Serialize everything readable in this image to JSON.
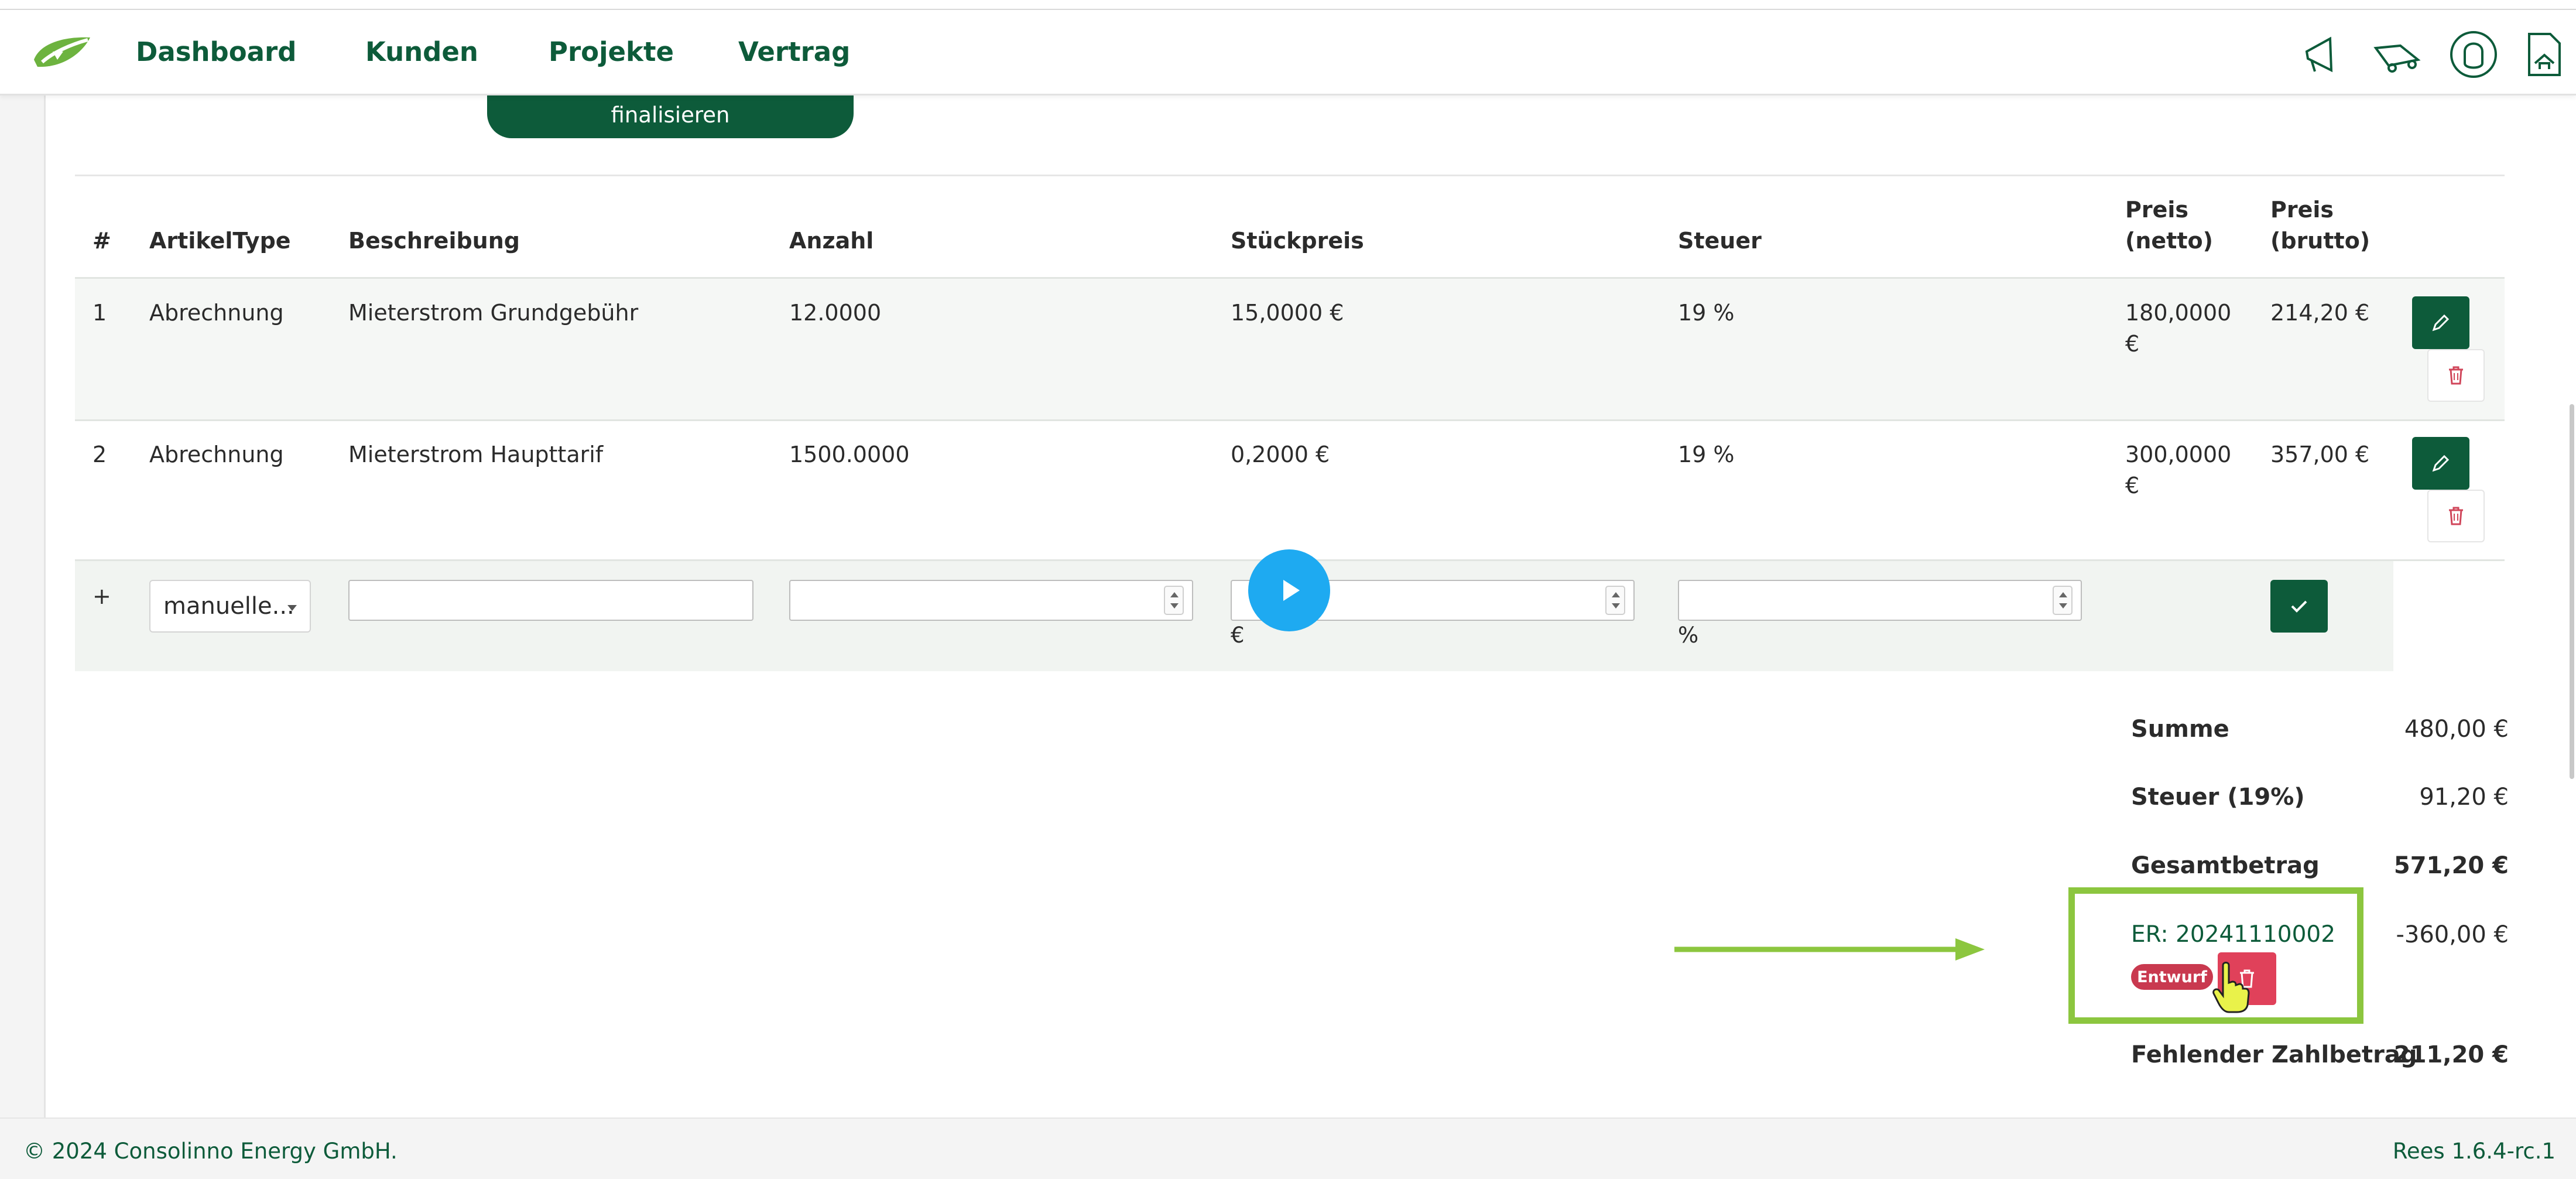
{
  "nav": {
    "items": [
      "Dashboard",
      "Kunden",
      "Projekte",
      "Vertrag"
    ]
  },
  "header_icons": [
    "megaphone-icon",
    "truck-icon",
    "user-support-icon",
    "document-icon"
  ],
  "actions": {
    "finalize_label": "finalisieren"
  },
  "table": {
    "headers": {
      "num": "#",
      "type": "ArtikelType",
      "desc": "Beschreibung",
      "qty": "Anzahl",
      "unit_price": "Stückpreis",
      "tax": "Steuer",
      "net_line1": "Preis",
      "net_line2": "(netto)",
      "gross_line1": "Preis",
      "gross_line2": "(brutto)"
    },
    "rows": [
      {
        "num": "1",
        "type": "Abrechnung",
        "desc": "Mieterstrom Grundgebühr",
        "qty": "12.0000",
        "unit_price": "15,0000 €",
        "tax": "19 %",
        "net_line1": "180,0000",
        "net_line2": "€",
        "gross": "214,20 €"
      },
      {
        "num": "2",
        "type": "Abrechnung",
        "desc": "Mieterstrom Haupttarif",
        "qty": "1500.0000",
        "unit_price": "0,2000 €",
        "tax": "19 %",
        "net_line1": "300,0000",
        "net_line2": "€",
        "gross": "357,00 €"
      }
    ],
    "new_row": {
      "plus": "+",
      "type_select": "manuelle...",
      "desc_value": "",
      "qty_value": "",
      "price_value": "",
      "tax_value": "",
      "price_unit": "€",
      "tax_unit": "%"
    }
  },
  "totals": {
    "sum_label": "Summe",
    "sum_value": "480,00 €",
    "tax_label": "Steuer (19%)",
    "tax_value": "91,20 €",
    "total_label": "Gesamtbetrag",
    "total_value": "571,20 €",
    "invoice_ref": "ER: 20241110002",
    "invoice_amount": "-360,00 €",
    "invoice_status": "Entwurf",
    "missing_label": "Fehlender Zahlbetrag",
    "missing_value": "211,20 €"
  },
  "footer": {
    "copyright": "© 2024 Consolinno Energy GmbH.",
    "version": "Rees 1.6.4-rc.1"
  },
  "colors": {
    "brand": "#0d5b3a",
    "danger": "#e0415a",
    "highlight": "#8cc63f",
    "play": "#1eaaf1"
  }
}
